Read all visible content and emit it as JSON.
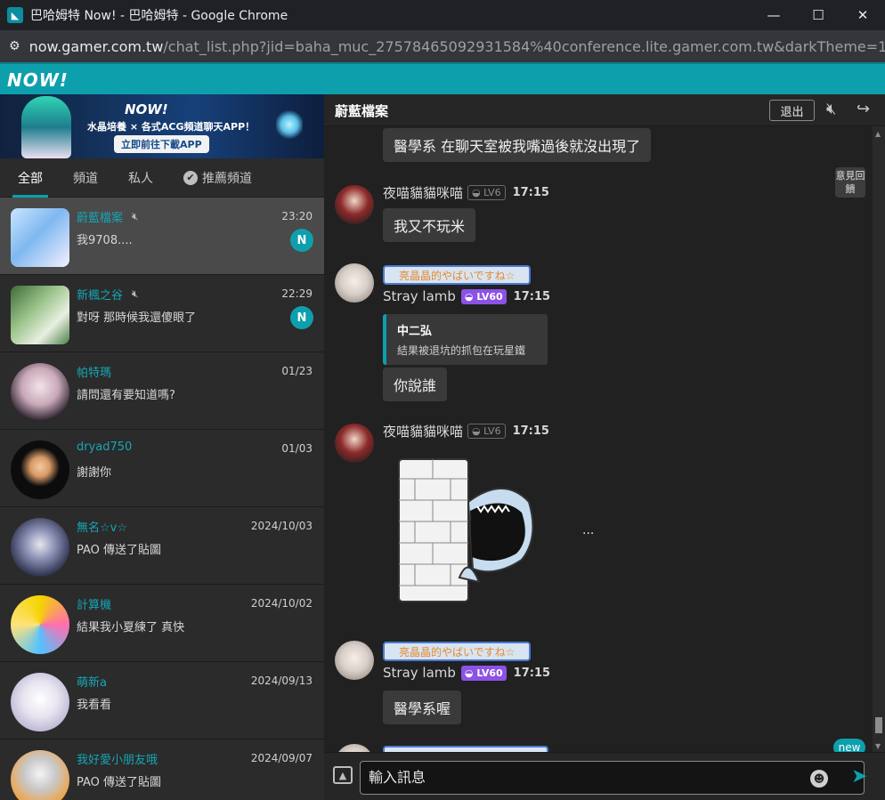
{
  "browser": {
    "title": "巴哈姆特 Now! - 巴哈姆特 - Google Chrome",
    "url_host": "now.gamer.com.tw",
    "url_path": "/chat_list.php?jid=baha_muc_27578465092931584%40conference.lite.gamer.com.tw&darkTheme=1",
    "win_minimize": "—",
    "win_maximize": "☐",
    "win_close": "✕"
  },
  "app": {
    "logo": "NOW!"
  },
  "banner": {
    "logo": "NOW!",
    "subtitle": "水晶培養 × 各式ACG頻道聊天APP！",
    "button": "立即前往下載APP"
  },
  "tabs": [
    {
      "label": "全部",
      "active": true
    },
    {
      "label": "頻道",
      "active": false
    },
    {
      "label": "私人",
      "active": false
    },
    {
      "label": "推薦頻道",
      "active": false
    }
  ],
  "chats": [
    {
      "name": "蔚藍檔案",
      "muted": true,
      "time": "23:20",
      "last": "我9708....",
      "badge": "N",
      "active": true
    },
    {
      "name": "新楓之谷",
      "muted": true,
      "time": "22:29",
      "last": "對呀 那時候我還傻眼了",
      "badge": "N",
      "active": false
    },
    {
      "name": "帕特瑪",
      "muted": false,
      "time": "01/23",
      "last": "請問還有要知道嗎?",
      "badge": "",
      "active": false
    },
    {
      "name": "dryad750",
      "muted": false,
      "time": "01/03",
      "last": "謝謝你",
      "badge": "",
      "active": false
    },
    {
      "name": "無名☆v☆",
      "muted": false,
      "time": "2024/10/03",
      "last": "PAO 傳送了貼圖",
      "badge": "",
      "active": false
    },
    {
      "name": "計算機",
      "muted": false,
      "time": "2024/10/02",
      "last": "結果我小夏練了 真快",
      "badge": "",
      "active": false
    },
    {
      "name": "萌新a",
      "muted": false,
      "time": "2024/09/13",
      "last": "我看看",
      "badge": "",
      "active": false
    },
    {
      "name": "我好愛小朋友哦",
      "muted": false,
      "time": "2024/09/07",
      "last": "PAO 傳送了貼圖",
      "badge": "",
      "active": false
    }
  ],
  "room": {
    "name": "蔚藍檔案",
    "exit_label": "退出",
    "feedback": "意見回饋",
    "new_label": "new",
    "input_placeholder": "輸入訊息"
  },
  "messages": {
    "m0_text": "醫學系 在聊天室被我嘴過後就沒出現了",
    "m1_sender": "夜喵貓貓咪喵",
    "m1_level": "LV6",
    "m1_time": "17:15",
    "m1_text": "我又不玩米",
    "m2_title": "亮晶晶的やばいですね☆",
    "m2_sender": "Stray lamb",
    "m2_level": "LV60",
    "m2_time": "17:15",
    "m2_quote_name": "中二弘",
    "m2_quote_text": "結果被退坑的抓包在玩星鐵",
    "m2_text": "你說誰",
    "m3_sender": "夜喵貓貓咪喵",
    "m3_level": "LV6",
    "m3_time": "17:15",
    "m3_ellipsis": "...",
    "m4_title": "亮晶晶的やばいですね☆",
    "m4_sender": "Stray lamb",
    "m4_level": "LV60",
    "m4_time": "17:15",
    "m4_text": "醫學系喔"
  },
  "colors": {
    "accent": "#0e9fad",
    "level_purple": "#8c52e6",
    "name_teal": "#16a6b6"
  }
}
